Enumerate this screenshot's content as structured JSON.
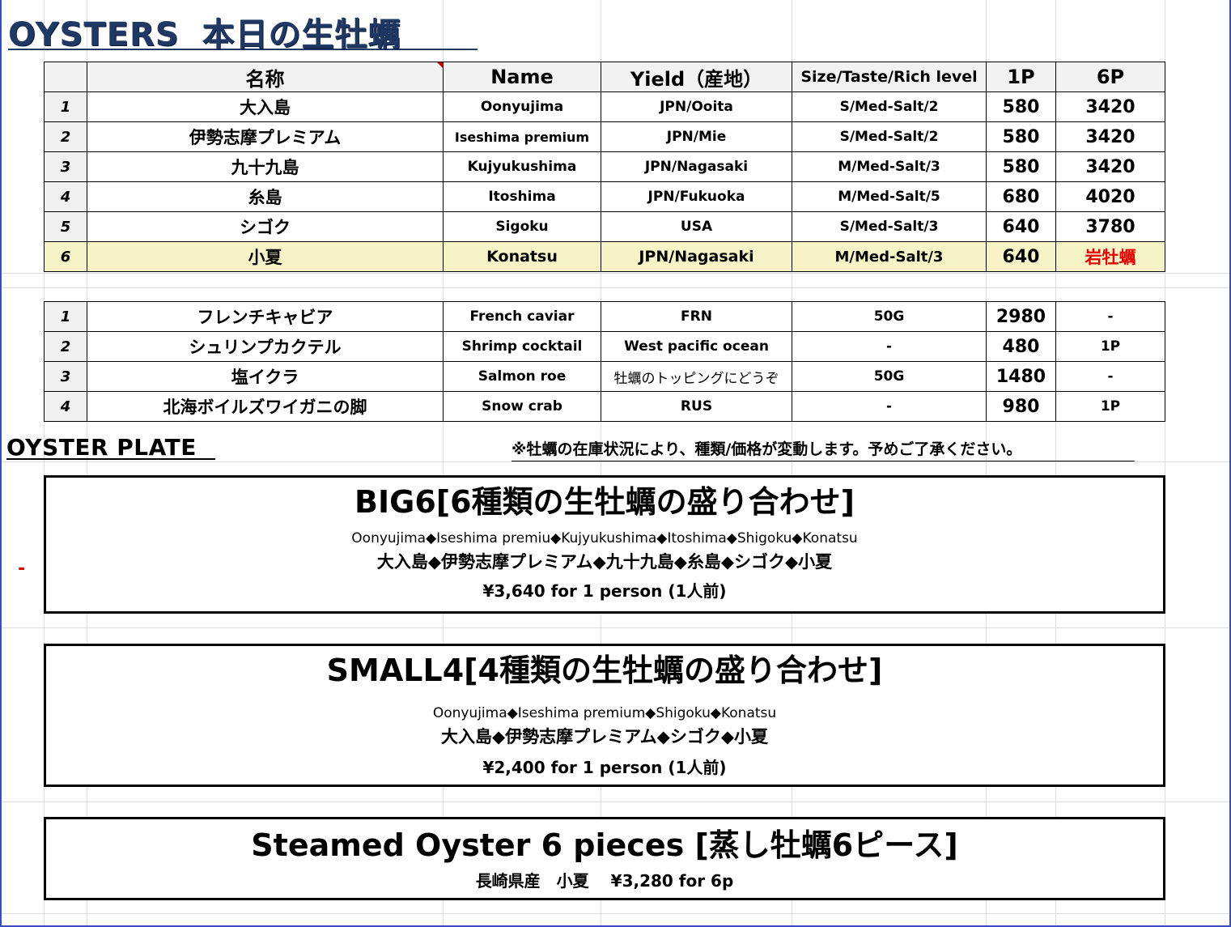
{
  "title": {
    "en": "OYSTERS",
    "jp": "本日の生牡蠣"
  },
  "oyster_table": {
    "headers": [
      "",
      "名称",
      "Name",
      "Yield（産地）",
      "Size/Taste/Rich level",
      "1P",
      "6P"
    ],
    "rows": [
      {
        "no": "1",
        "jp": "大入島",
        "name": "Oonyujima",
        "yield": "JPN/Ooita",
        "size": "S/Med-Salt/2",
        "p1": "580",
        "p6": "3420"
      },
      {
        "no": "2",
        "jp": "伊勢志摩プレミアム",
        "name": "Iseshima premium",
        "yield": "JPN/Mie",
        "size": "S/Med-Salt/2",
        "p1": "580",
        "p6": "3420"
      },
      {
        "no": "3",
        "jp": "九十九島",
        "name": "Kujyukushima",
        "yield": "JPN/Nagasaki",
        "size": "M/Med-Salt/3",
        "p1": "580",
        "p6": "3420"
      },
      {
        "no": "4",
        "jp": "糸島",
        "name": "Itoshima",
        "yield": "JPN/Fukuoka",
        "size": "M/Med-Salt/5",
        "p1": "680",
        "p6": "4020"
      },
      {
        "no": "5",
        "jp": "シゴク",
        "name": "Sigoku",
        "yield": "USA",
        "size": "S/Med-Salt/3",
        "p1": "640",
        "p6": "3780"
      },
      {
        "no": "6",
        "jp": "小夏",
        "name": "Konatsu",
        "yield": "JPN/Nagasaki",
        "size": "M/Med-Salt/3",
        "p1": "640",
        "p6": "岩牡蠣"
      }
    ]
  },
  "extras_table": {
    "rows": [
      {
        "no": "1",
        "jp": "フレンチキャビア",
        "name": "French caviar",
        "yield": "FRN",
        "size": "50G",
        "p1": "2980",
        "p6": "-"
      },
      {
        "no": "2",
        "jp": "シュリンプカクテル",
        "name": "Shrimp cocktail",
        "yield": "West pacific ocean",
        "size": "-",
        "p1": "480",
        "p6": "1P"
      },
      {
        "no": "3",
        "jp": "塩イクラ",
        "name": "Salmon roe",
        "yield": "牡蠣のトッピングにどうぞ",
        "size": "50G",
        "p1": "1480",
        "p6": "-"
      },
      {
        "no": "4",
        "jp": "北海ボイルズワイガニの脚",
        "name": "Snow crab",
        "yield": "RUS",
        "size": "-",
        "p1": "980",
        "p6": "1P"
      }
    ]
  },
  "plate_section": {
    "label": "OYSTER PLATE",
    "notice": "※牡蠣の在庫状況により、種類/価格が変動します。予めご了承ください。"
  },
  "plates": [
    {
      "title": "BIG6[6種類の生牡蠣の盛り合わせ]",
      "en": "Oonyujima◆Iseshima premiu◆Kujyukushima◆Itoshima◆Shigoku◆Konatsu",
      "jp": "大入島◆伊勢志摩プレミアム◆九十九島◆糸島◆シゴク◆小夏",
      "price": "¥3,640 for 1 person (1人前)"
    },
    {
      "title": "SMALL4[4種類の生牡蠣の盛り合わせ]",
      "en": "Oonyujima◆Iseshima premium◆Shigoku◆Konatsu",
      "jp": "大入島◆伊勢志摩プレミアム◆シゴク◆小夏",
      "price": "¥2,400 for 1 person (1人前)"
    },
    {
      "title": "Steamed Oyster 6 pieces [蒸し牡蠣6ピース]",
      "subtitle": "長崎県産　小夏　 ¥3,280 for 6p"
    }
  ],
  "stray_mark": "-",
  "colors": {
    "title": "#1f3864",
    "highlight_row": "#f6f3c6",
    "red_text": "#e60000",
    "header_bg": "#f2f2f2"
  }
}
